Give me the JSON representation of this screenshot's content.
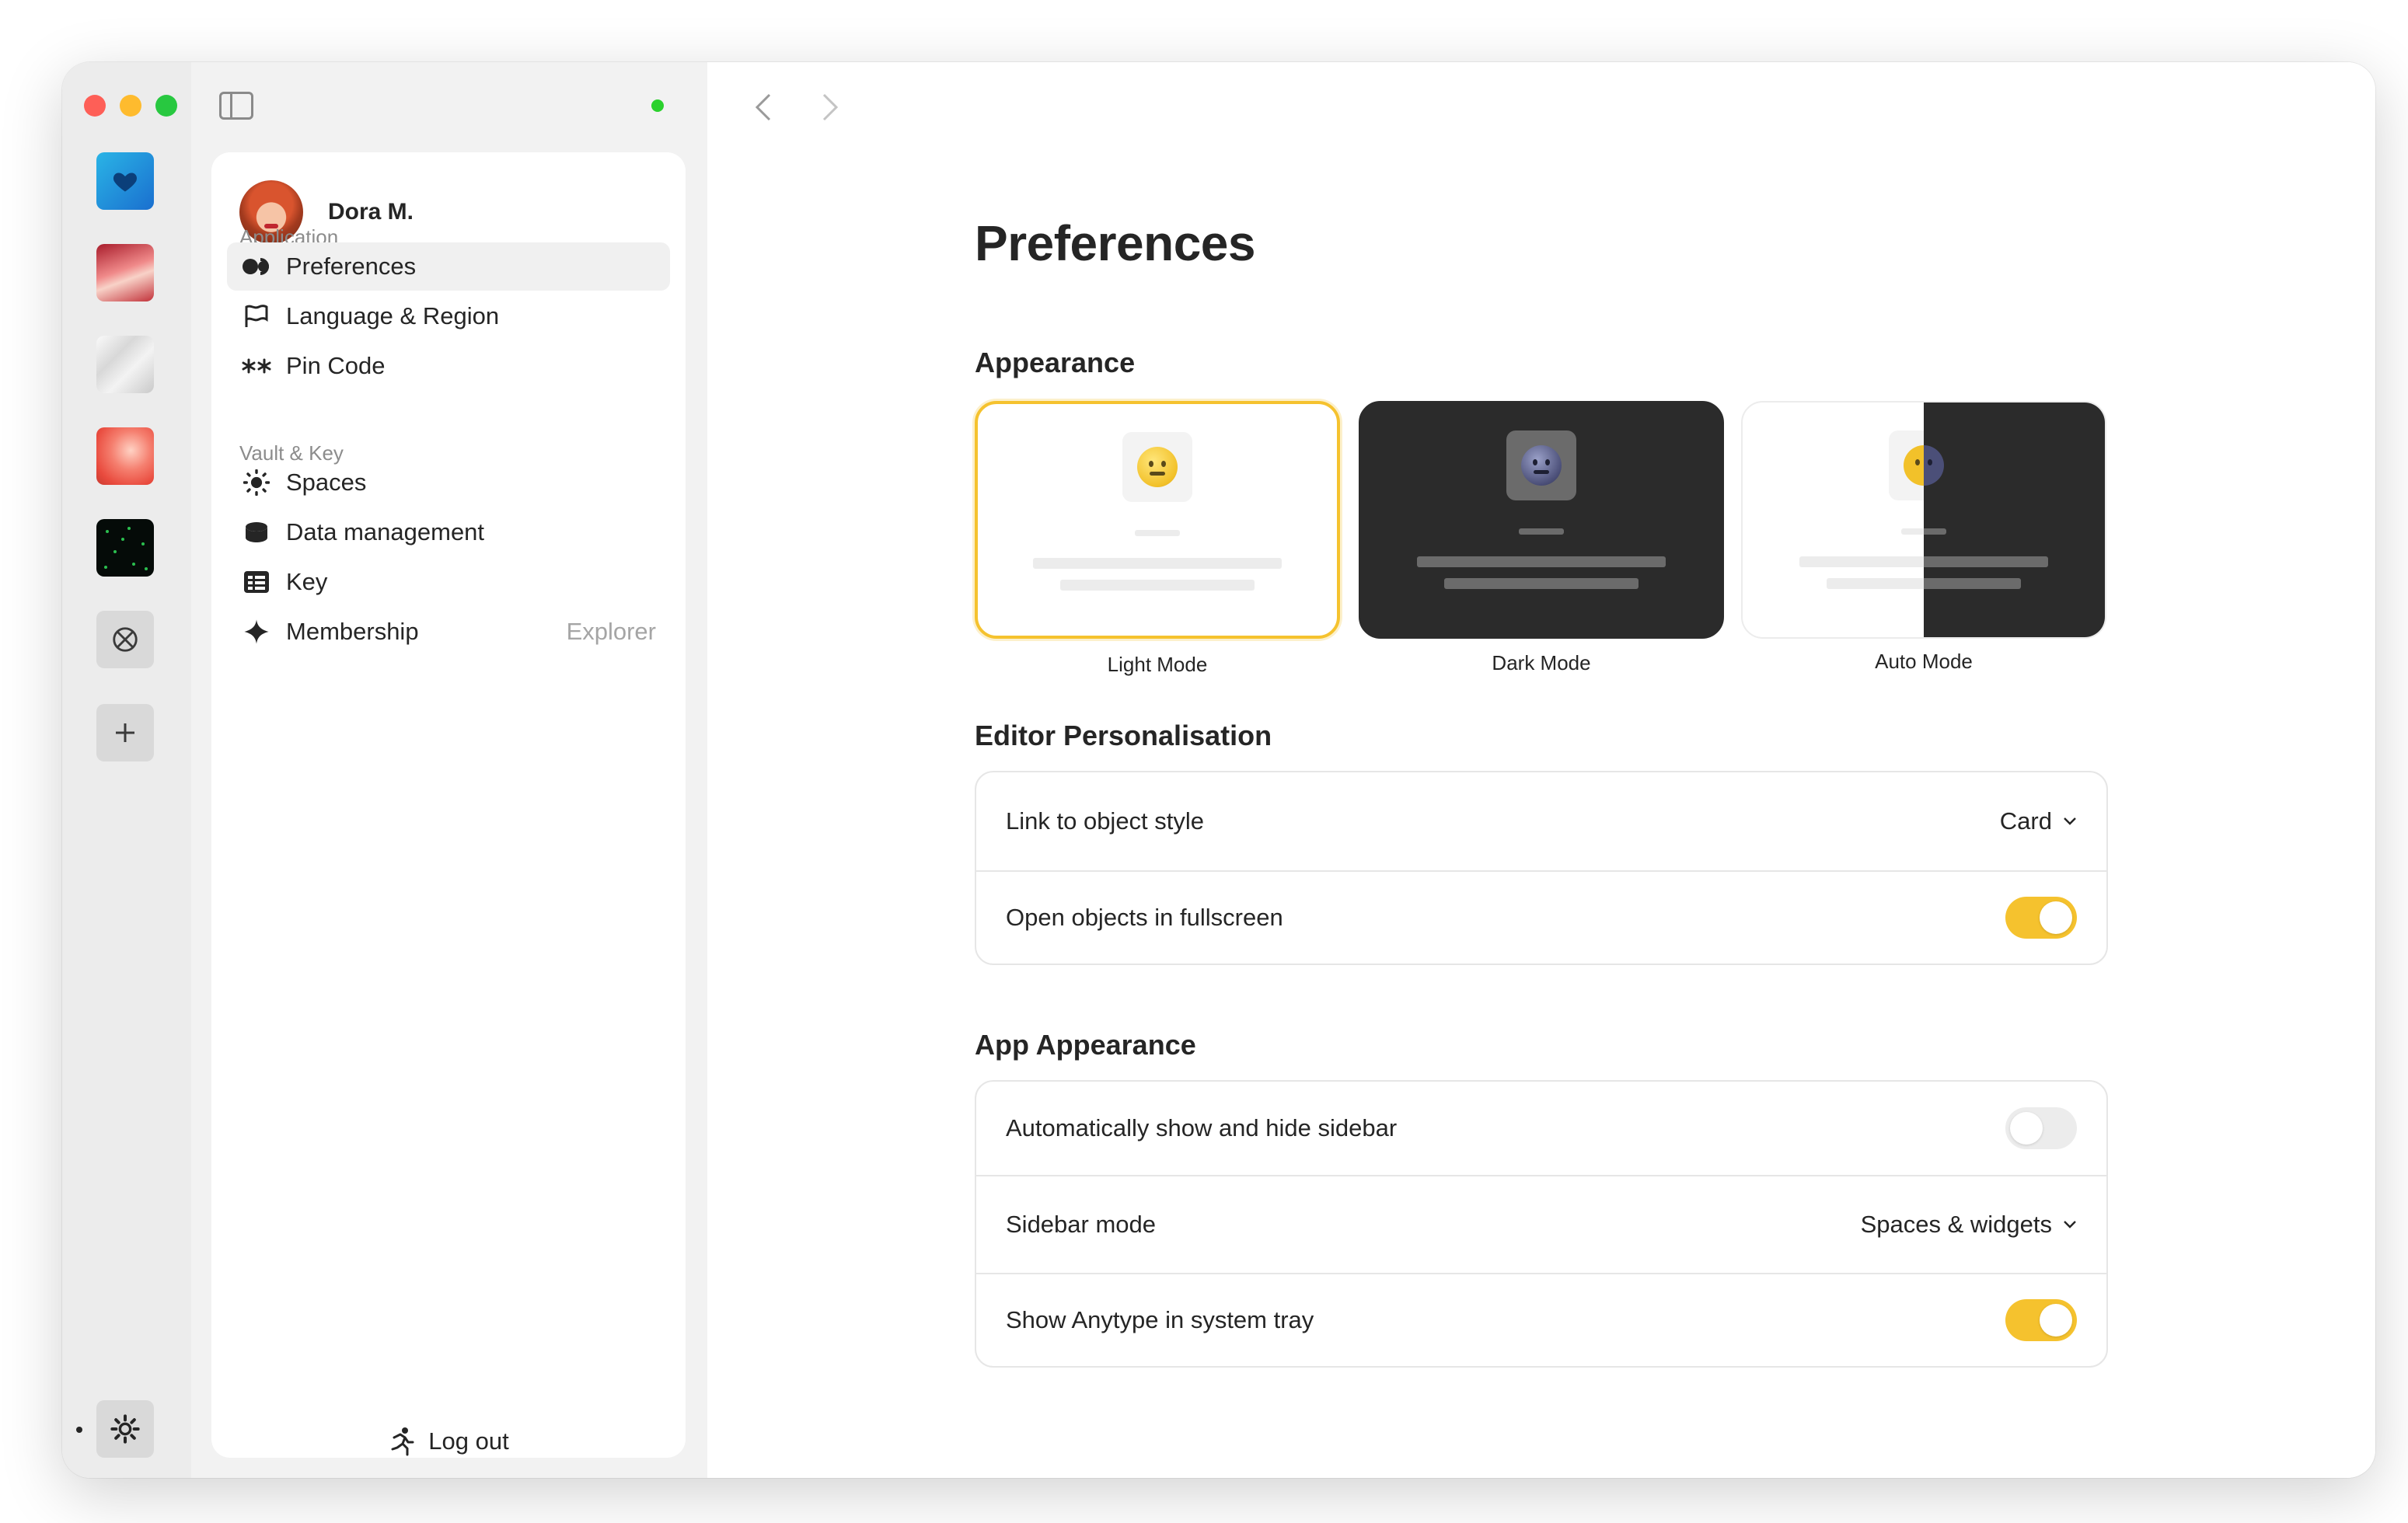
{
  "profile": {
    "name": "Dora M."
  },
  "sidebar": {
    "sections": [
      {
        "label": "Application",
        "items": [
          {
            "label": "Preferences",
            "icon": "toggle-icon",
            "active": true
          },
          {
            "label": "Language & Region",
            "icon": "flag-icon"
          },
          {
            "label": "Pin Code",
            "icon": "asterisks-icon"
          }
        ]
      },
      {
        "label": "Vault & Key",
        "items": [
          {
            "label": "Spaces",
            "icon": "sun-icon"
          },
          {
            "label": "Data management",
            "icon": "database-icon"
          },
          {
            "label": "Key",
            "icon": "key-table-icon"
          },
          {
            "label": "Membership",
            "icon": "sparkle-icon",
            "badge": "Explorer"
          }
        ]
      }
    ],
    "logout_label": "Log out"
  },
  "main": {
    "title": "Preferences",
    "appearance": {
      "title": "Appearance",
      "modes": [
        {
          "label": "Light Mode",
          "selected": true
        },
        {
          "label": "Dark Mode",
          "selected": false
        },
        {
          "label": "Auto Mode",
          "selected": false
        }
      ]
    },
    "editor": {
      "title": "Editor Personalisation",
      "rows": [
        {
          "label": "Link to object style",
          "type": "select",
          "value": "Card"
        },
        {
          "label": "Open objects in fullscreen",
          "type": "toggle",
          "value": true
        }
      ]
    },
    "app_appearance": {
      "title": "App Appearance",
      "rows": [
        {
          "label": "Automatically show and hide sidebar",
          "type": "toggle",
          "value": false
        },
        {
          "label": "Sidebar mode",
          "type": "select",
          "value": "Spaces & widgets"
        },
        {
          "label": "Show Anytype in system tray",
          "type": "toggle",
          "value": true
        }
      ]
    }
  },
  "colors": {
    "accent": "#f5c22e",
    "online": "#2bd12d",
    "dark_mode_bg": "#2b2b2b"
  }
}
